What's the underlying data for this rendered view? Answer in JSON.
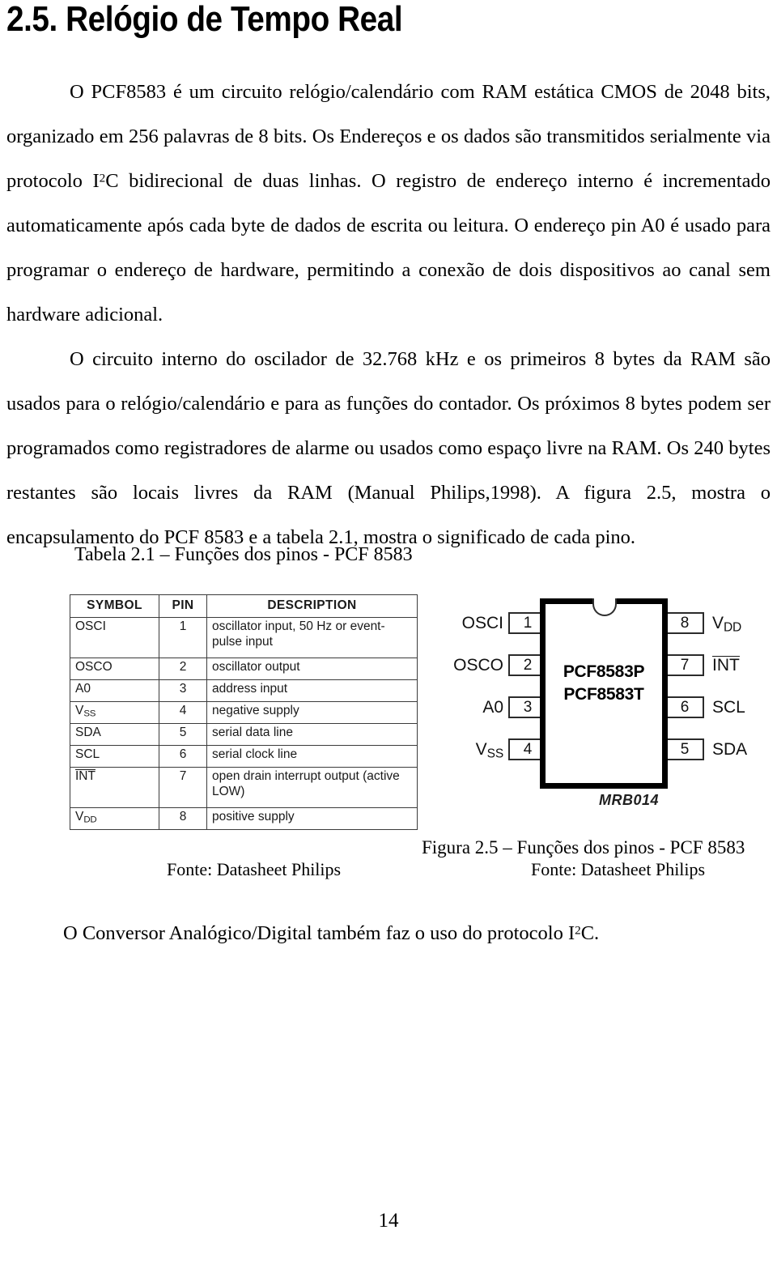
{
  "document": {
    "heading": "2.5. Relógio de Tempo Real",
    "page_number": "14",
    "paragraphs": {
      "p1_part1": "O PCF8583 é um circuito relógio/calendário com RAM estática CMOS de 2048 bits, organizado em 256 palavras de 8 bits. Os Endereços e os dados são transmitidos serialmente via protocolo I",
      "p1_sup": "2",
      "p1_part2": "C bidirecional de duas linhas. O registro de endereço interno é incrementado automaticamente após cada byte de dados de escrita ou leitura. O endereço pin A0 é usado para programar o endereço de hardware, permitindo a conexão de dois dispositivos ao canal sem hardware adicional.",
      "p2": "O circuito interno do oscilador de 32.768 kHz e os primeiros 8 bytes da RAM são usados para o relógio/calendário e para as funções do contador. Os próximos 8 bytes podem ser programados como registradores de alarme ou usados como espaço livre na RAM. Os 240 bytes restantes são locais livres da RAM (Manual Philips,1998). A figura 2.5, mostra o encapsulamento do PCF 8583 e a tabela 2.1, mostra o significado de cada pino.",
      "closing_part1": "O Conversor Analógico/Digital também faz o uso do protocolo I",
      "closing_sup": "2",
      "closing_part2": "C."
    }
  },
  "table": {
    "caption": "Tabela 2.1 – Funções dos pinos - PCF 8583",
    "source": "Fonte: Datasheet Philips",
    "headers": {
      "symbol": "SYMBOL",
      "pin": "PIN",
      "description": "DESCRIPTION"
    },
    "rows": [
      {
        "symbol": "OSCI",
        "symbol_sub": "",
        "overline": false,
        "pin": "1",
        "description": "oscillator input, 50 Hz or event-pulse input",
        "tall": true
      },
      {
        "symbol": "OSCO",
        "symbol_sub": "",
        "overline": false,
        "pin": "2",
        "description": "oscillator output",
        "tall": false
      },
      {
        "symbol": "A0",
        "symbol_sub": "",
        "overline": false,
        "pin": "3",
        "description": "address input",
        "tall": false
      },
      {
        "symbol": "V",
        "symbol_sub": "SS",
        "overline": false,
        "pin": "4",
        "description": "negative supply",
        "tall": false
      },
      {
        "symbol": "SDA",
        "symbol_sub": "",
        "overline": false,
        "pin": "5",
        "description": "serial data line",
        "tall": false
      },
      {
        "symbol": "SCL",
        "symbol_sub": "",
        "overline": false,
        "pin": "6",
        "description": "serial clock line",
        "tall": false
      },
      {
        "symbol": "INT",
        "symbol_sub": "",
        "overline": true,
        "pin": "7",
        "description": "open drain interrupt output (active LOW)",
        "tall": true
      },
      {
        "symbol": "V",
        "symbol_sub": "DD",
        "overline": false,
        "pin": "8",
        "description": "positive supply",
        "tall": false
      }
    ]
  },
  "figure": {
    "caption": "Figura 2.5 – Funções dos pinos - PCF 8583",
    "source": "Fonte: Datasheet Philips",
    "chip_lines": [
      "PCF8583P",
      "PCF8583T"
    ],
    "chip_code": "MRB014",
    "pins_left": [
      {
        "label": "OSCI",
        "sub": "",
        "overline": false,
        "number": "1"
      },
      {
        "label": "OSCO",
        "sub": "",
        "overline": false,
        "number": "2"
      },
      {
        "label": "A0",
        "sub": "",
        "overline": false,
        "number": "3"
      },
      {
        "label": "V",
        "sub": "SS",
        "overline": false,
        "number": "4"
      }
    ],
    "pins_right": [
      {
        "label": "V",
        "sub": "DD",
        "overline": false,
        "number": "8"
      },
      {
        "label": "INT",
        "sub": "",
        "overline": true,
        "number": "7"
      },
      {
        "label": "SCL",
        "sub": "",
        "overline": false,
        "number": "6"
      },
      {
        "label": "SDA",
        "sub": "",
        "overline": false,
        "number": "5"
      }
    ]
  },
  "colors": {
    "text": "#000000",
    "table_border": "#3b3b3b",
    "chip_outline": "#000000",
    "background": "#ffffff"
  }
}
